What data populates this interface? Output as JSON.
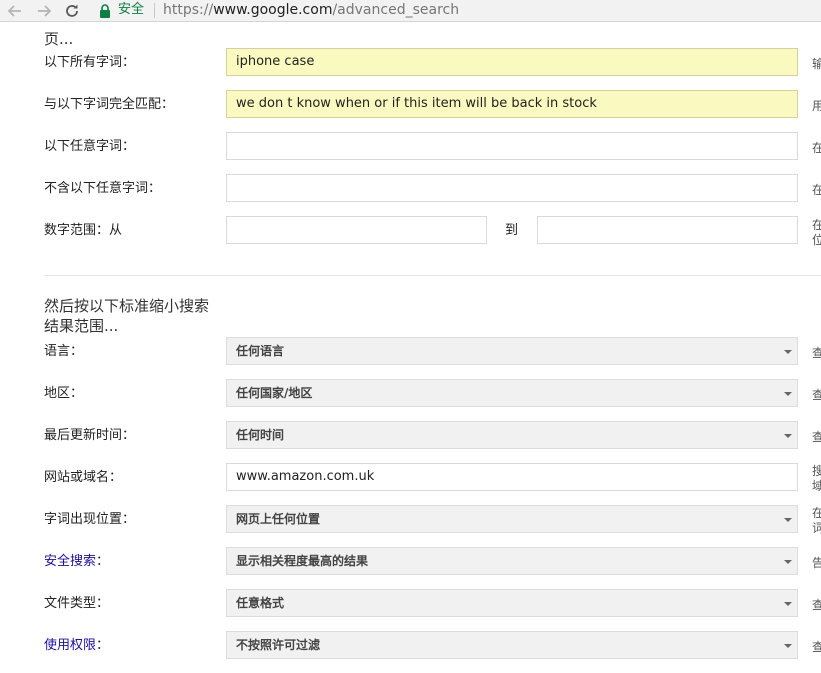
{
  "browser": {
    "secure_label": "安全",
    "url_scheme": "https://",
    "url_host": "www.google.com",
    "url_path": "/advanced_search",
    "secure_color": "#0b8043"
  },
  "top_section": {
    "heading_tail": "页..."
  },
  "rows": {
    "all_words": {
      "label": "以下所有字词：",
      "value": "iphone case",
      "hint": "输"
    },
    "exact_phrase": {
      "label": "与以下字词完全匹配：",
      "value": "we don t know when or if this item will be back in stock",
      "hint": "用"
    },
    "any_words": {
      "label": "以下任意字词：",
      "value": "",
      "hint": "在"
    },
    "none_words": {
      "label": "不含以下任意字词：",
      "value": "",
      "hint": "在"
    },
    "number_range": {
      "label": "数字范围：从",
      "to_label": "到",
      "from_value": "",
      "to_value": "",
      "hint1": "在",
      "hint2": "位"
    }
  },
  "narrow_section": {
    "title_line1": "然后按以下标准缩小搜索",
    "title_line2": "结果范围..."
  },
  "filters": {
    "language": {
      "label": "语言：",
      "value": "任何语言",
      "hint": "查"
    },
    "region": {
      "label": "地区：",
      "value": "任何国家/地区",
      "hint": "查"
    },
    "last_update": {
      "label": "最后更新时间：",
      "value": "任何时间",
      "hint": "查"
    },
    "site": {
      "label": "网站或域名：",
      "value": "www.amazon.com.uk",
      "hint1": "搜",
      "hint2": "域"
    },
    "terms_appearing": {
      "label": "字词出现位置：",
      "value": "网页上任何位置",
      "hint1": "在",
      "hint2": "词"
    },
    "safe_search": {
      "label": "安全搜索",
      "colon": "：",
      "value": "显示相关程度最高的结果",
      "hint": "告"
    },
    "file_type": {
      "label": "文件类型：",
      "value": "任意格式",
      "hint": "查"
    },
    "usage_rights": {
      "label": "使用权限",
      "colon": "：",
      "value": "不按照许可过滤",
      "hint": "查"
    }
  },
  "colors": {
    "link": "#1a0dab",
    "filled_field_bg": "#fafac0",
    "select_bg": "#f1f1f1"
  }
}
